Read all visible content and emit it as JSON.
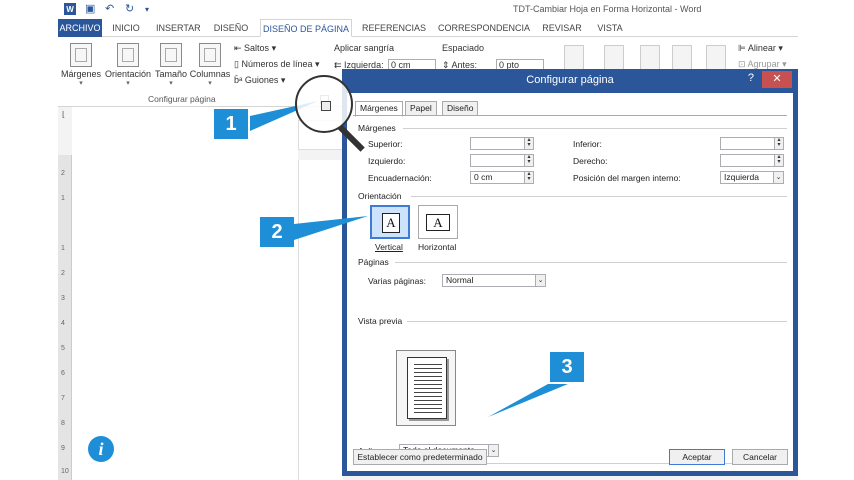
{
  "window": {
    "title": "TDT-Cambiar Hoja en Forma Horizontal - Word",
    "word_logo": "W"
  },
  "tabs": [
    "ARCHIVO",
    "INICIO",
    "INSERTAR",
    "DISEÑO",
    "DISEÑO DE PÁGINA",
    "REFERENCIAS",
    "CORRESPONDENCIA",
    "REVISAR",
    "VISTA"
  ],
  "ribbon": {
    "big_buttons": [
      "Márgenes",
      "Orientación",
      "Tamaño",
      "Columnas"
    ],
    "saltos": "Saltos",
    "numeros_linea": "Números de línea",
    "guiones": "Guiones",
    "group_label": "Configurar página",
    "aplicar_sangria": "Aplicar sangría",
    "izquierda_label": "Izquierda:",
    "izquierda_value": "0 cm",
    "espaciado": "Espaciado",
    "antes_label": "Antes:",
    "antes_value": "0 pto",
    "alinear": "Alinear",
    "agrupar": "Agrupar"
  },
  "ruler_marks": [
    "2",
    "1",
    "1",
    "2",
    "3",
    "4",
    "5",
    "6",
    "7",
    "8",
    "9",
    "10"
  ],
  "dialog": {
    "title": "Configurar página",
    "help": "?",
    "close": "✕",
    "tabs": [
      "Márgenes",
      "Papel",
      "Diseño"
    ],
    "margins_section": "Márgenes",
    "superior_label": "Superior:",
    "superior_value": "",
    "inferior_label": "Inferior:",
    "inferior_value": "",
    "izquierdo_label": "Izquierdo:",
    "izquierdo_value": "",
    "derecho_label": "Derecho:",
    "derecho_value": "",
    "encuadernacion_label": "Encuadernación:",
    "encuadernacion_value": "0 cm",
    "posicion_label": "Posición del margen interno:",
    "posicion_value": "Izquierda",
    "orientation_section": "Orientación",
    "vertical_label": "Vertical",
    "horizontal_label": "Horizontal",
    "orientation_glyph": "A",
    "selected_orientation": "Vertical",
    "pages_section": "Páginas",
    "varias_paginas_label": "Varias páginas:",
    "varias_paginas_value": "Normal",
    "preview_section": "Vista previa",
    "aplicar_label": "Aplicar a:",
    "aplicar_value": "Todo el documento",
    "default_button": "Establecer como predeterminado",
    "ok_button": "Aceptar",
    "cancel_button": "Cancelar"
  },
  "callouts": [
    "1",
    "2",
    "3"
  ],
  "info_icon": "i",
  "colors": {
    "accent": "#2b579a",
    "callout": "#1e8fd6",
    "close": "#c75050"
  }
}
